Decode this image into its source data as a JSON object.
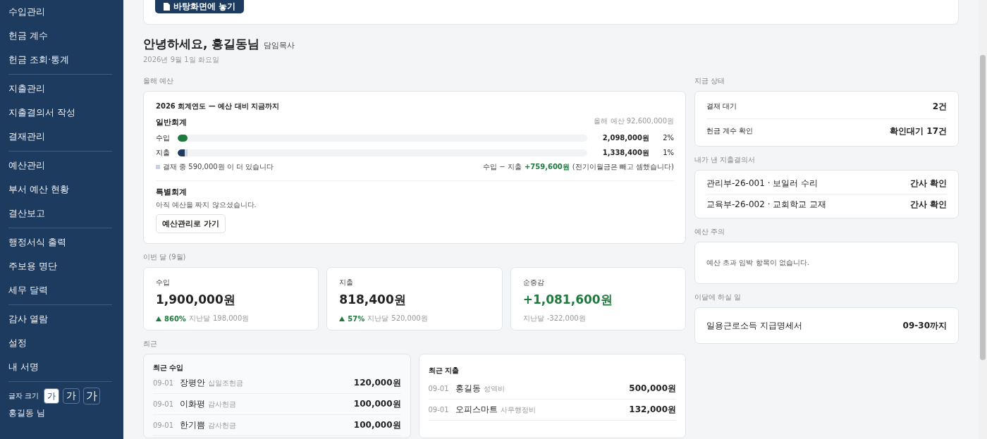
{
  "sidebar": {
    "groups": [
      [
        "수입관리",
        "헌금 계수",
        "헌금 조회·통계"
      ],
      [
        "지출관리",
        "지출결의서 작성",
        "결재관리"
      ],
      [
        "예산관리",
        "부서 예산 현황",
        "결산보고"
      ],
      [
        "행정서식 출력",
        "주보용 명단",
        "세무 달력"
      ],
      [
        "감사 열람",
        "설정",
        "내 서명"
      ]
    ],
    "font_size": {
      "label": "글자 크기",
      "options": [
        {
          "label": "가",
          "selected": true
        },
        {
          "label": "가",
          "selected": false
        },
        {
          "label": "가",
          "selected": false
        }
      ]
    },
    "user": "홍길동 님"
  },
  "top_button": "바탕화면에 놓기",
  "greeting": {
    "title": "안녕하세요, 홍길동님",
    "role": "담임목사",
    "date": "2026년 9월 1일 화요일"
  },
  "budget": {
    "section": "올해 예산",
    "title": "2026 회계연도 — 예산 대비 지금까지",
    "general": {
      "title": "일반회계",
      "budget_note": "올해 예산 92,600,000원",
      "bars": [
        {
          "kind": "income",
          "label": "수입",
          "level": 0.023,
          "amount": "2,098,000원",
          "percent": "2%"
        },
        {
          "kind": "expense",
          "label": "지출",
          "level": 0.0145,
          "pending": {
            "level": 0.0064
          },
          "amount": "1,338,400원",
          "percent": "1%"
        }
      ],
      "pending_note": "결재 중 590,000원 이 더 있습니다",
      "net_label": "수입 − 지출",
      "net_value": "+759,600원",
      "net_note": "(전기이월금은 빼고 셈했습니다)"
    },
    "special": {
      "title": "특별회계",
      "note": "아직 예산을 짜지 않으셨습니다.",
      "button": "예산관리로 가기"
    }
  },
  "month": {
    "section": "이번 달 (9월)",
    "cards": [
      {
        "label": "수입",
        "value": "1,900,000원",
        "positive": false,
        "change": "860%",
        "prev_label": "지난달",
        "prev_value": "198,000원"
      },
      {
        "label": "지출",
        "value": "818,400원",
        "positive": false,
        "change": "57%",
        "prev_label": "지난달",
        "prev_value": "520,000원"
      },
      {
        "label": "순증감",
        "value": "+1,081,600원",
        "positive": true,
        "prev_label": "지난달",
        "prev_value": "-322,000원"
      }
    ]
  },
  "recent": {
    "section": "최근",
    "income": {
      "title": "최근 수입",
      "rows": [
        {
          "date": "09-01",
          "name": "장평안",
          "category": "십일조헌금",
          "amount": "120,000원"
        },
        {
          "date": "09-01",
          "name": "이화평",
          "category": "감사헌금",
          "amount": "100,000원"
        },
        {
          "date": "09-01",
          "name": "한기쁨",
          "category": "감사헌금",
          "amount": "100,000원"
        }
      ]
    },
    "expense": {
      "title": "최근 지출",
      "rows": [
        {
          "date": "09-01",
          "name": "홍길동",
          "category": "성역비",
          "amount": "500,000원"
        },
        {
          "date": "09-01",
          "name": "오피스마트",
          "category": "사무행정비",
          "amount": "132,000원"
        }
      ]
    }
  },
  "status": {
    "section": "지금 상태",
    "rows": [
      {
        "label": "결재 대기",
        "value": "2건"
      },
      {
        "label": "헌금 계수 확인",
        "value": "확인대기 17건"
      }
    ]
  },
  "my_docs": {
    "section": "내가 낸 지출결의서",
    "rows": [
      {
        "title": "관리부-26-001 · 보일러 수리",
        "status": "간사 확인"
      },
      {
        "title": "교육부-26-002 · 교회학교 교재",
        "status": "간사 확인"
      }
    ]
  },
  "alert": {
    "section": "예산 주의",
    "message": "예산 초과 임박 항목이 없습니다."
  },
  "todo": {
    "section": "이달에 하실 일",
    "rows": [
      {
        "title": "일용근로소득 지급명세서",
        "due": "09-30까지"
      }
    ]
  }
}
